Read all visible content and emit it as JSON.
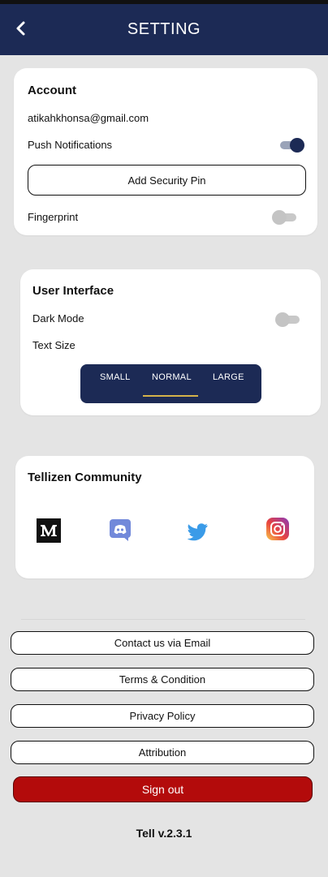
{
  "header": {
    "title": "SETTING",
    "back_icon": "chevron-left-icon"
  },
  "account": {
    "title": "Account",
    "email": "atikahkhonsa@gmail.com",
    "push_label": "Push Notifications",
    "push_on": true,
    "security_pin_label": "Add Security Pin",
    "fingerprint_label": "Fingerprint",
    "fingerprint_on": false
  },
  "ui": {
    "title": "User Interface",
    "dark_mode_label": "Dark Mode",
    "dark_mode_on": false,
    "text_size_label": "Text Size",
    "sizes": [
      "SMALL",
      "NORMAL",
      "LARGE"
    ],
    "selected_size": "NORMAL"
  },
  "community": {
    "title": "Tellizen Community",
    "links": [
      "medium-icon",
      "discord-icon",
      "twitter-icon",
      "instagram-icon"
    ]
  },
  "links": {
    "contact": "Contact us via Email",
    "terms": "Terms & Condition",
    "privacy": "Privacy Policy",
    "attribution": "Attribution"
  },
  "signout_label": "Sign out",
  "version": "Tell v.2.3.1",
  "colors": {
    "header": "#1c2a55",
    "signout": "#b30b0b",
    "accent_underline": "#d4b24a"
  }
}
